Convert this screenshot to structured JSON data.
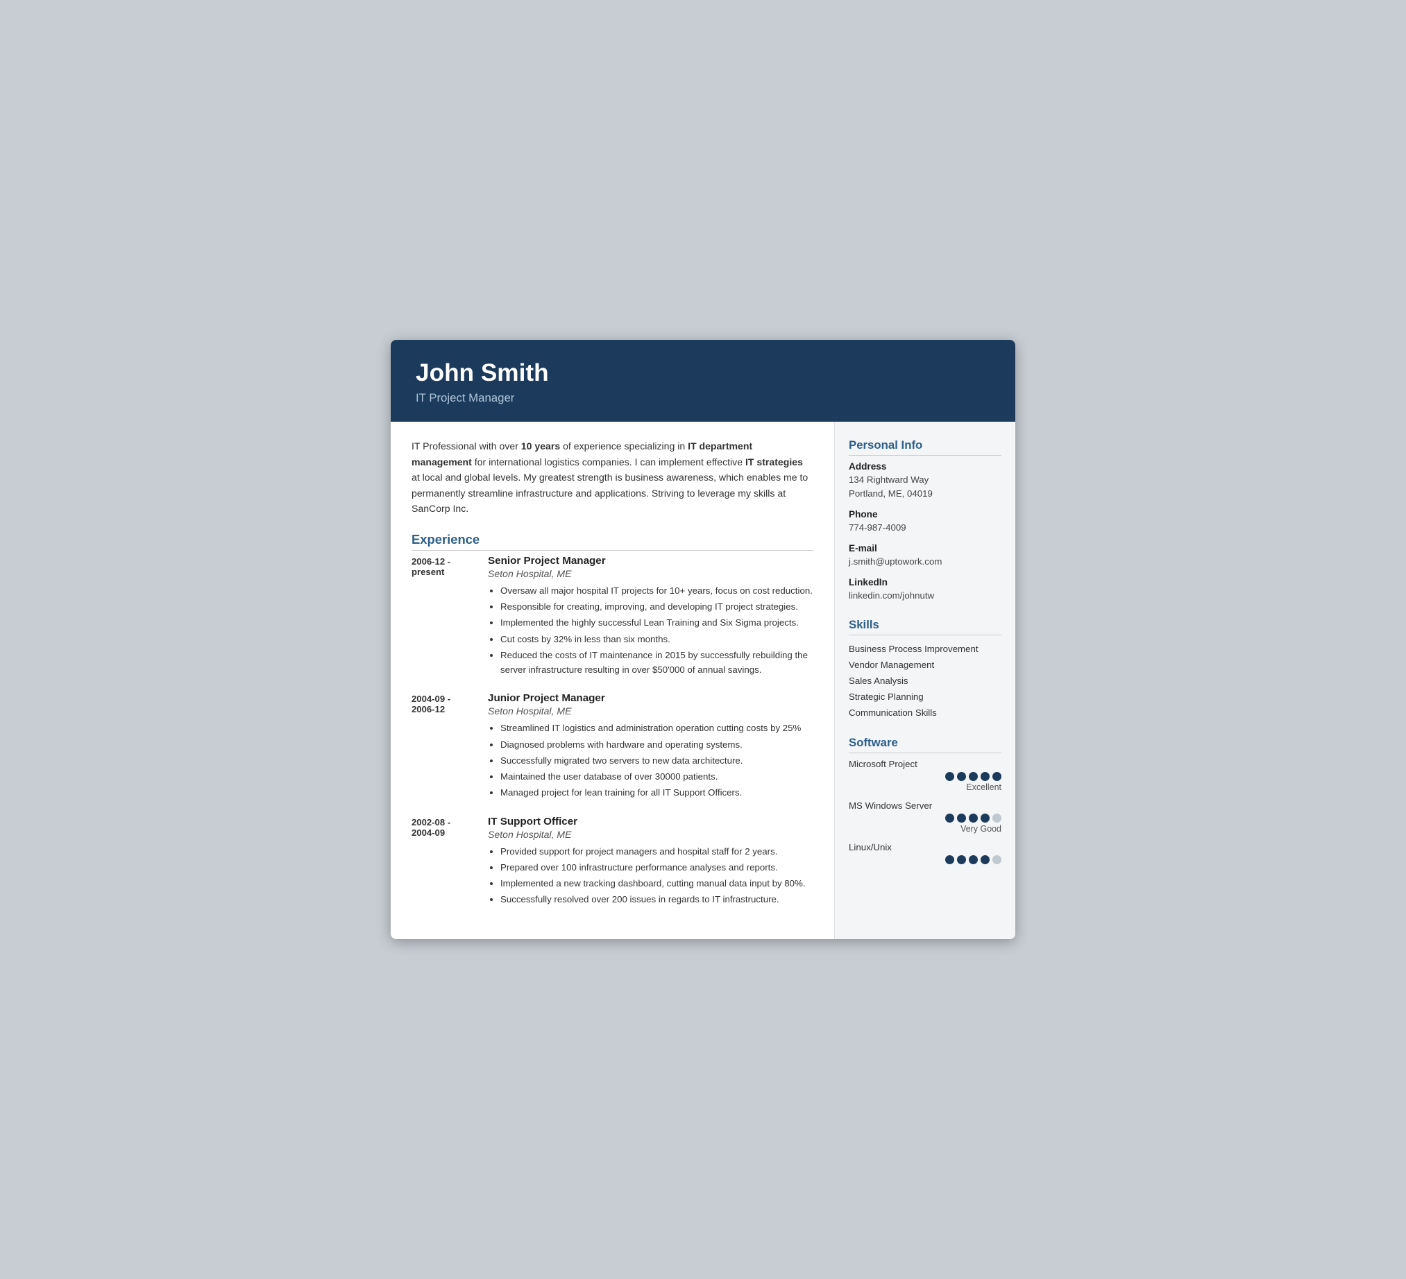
{
  "header": {
    "name": "John Smith",
    "title": "IT Project Manager"
  },
  "summary": {
    "text_parts": [
      {
        "text": "IT Professional with over ",
        "bold": false
      },
      {
        "text": "10 years",
        "bold": true
      },
      {
        "text": " of experience specializing in ",
        "bold": false
      },
      {
        "text": "IT department management",
        "bold": true
      },
      {
        "text": " for international logistics companies. I can implement effective ",
        "bold": false
      },
      {
        "text": "IT strategies",
        "bold": true
      },
      {
        "text": " at local and global levels. My greatest strength is business awareness, which enables me to permanently streamline infrastructure and applications. Striving to leverage my skills at SanCorp Inc.",
        "bold": false
      }
    ]
  },
  "experience": {
    "section_label": "Experience",
    "entries": [
      {
        "date_start": "2006-12 -",
        "date_end": "present",
        "title": "Senior Project Manager",
        "company": "Seton Hospital, ME",
        "bullets": [
          "Oversaw all major hospital IT projects for 10+ years, focus on cost reduction.",
          "Responsible for creating, improving, and developing IT project strategies.",
          "Implemented the highly successful Lean Training and Six Sigma projects.",
          "Cut costs by 32% in less than six months.",
          "Reduced the costs of IT maintenance in 2015 by successfully rebuilding the server infrastructure resulting in over $50'000 of annual savings."
        ]
      },
      {
        "date_start": "2004-09 -",
        "date_end": "2006-12",
        "title": "Junior Project Manager",
        "company": "Seton Hospital, ME",
        "bullets": [
          "Streamlined IT logistics and administration operation cutting costs by 25%",
          "Diagnosed problems with hardware and operating systems.",
          "Successfully migrated two servers to new data architecture.",
          "Maintained the user database of over 30000 patients.",
          "Managed project for lean training for all IT Support Officers."
        ]
      },
      {
        "date_start": "2002-08 -",
        "date_end": "2004-09",
        "title": "IT Support Officer",
        "company": "Seton Hospital, ME",
        "bullets": [
          "Provided support for project managers and hospital staff for 2 years.",
          "Prepared over 100 infrastructure performance analyses and reports.",
          "Implemented a new tracking dashboard, cutting manual data input by 80%.",
          "Successfully resolved over 200 issues in regards to IT infrastructure."
        ]
      }
    ]
  },
  "sidebar": {
    "personal_info": {
      "section_label": "Personal Info",
      "fields": [
        {
          "label": "Address",
          "value": "134 Rightward Way\nPortland, ME, 04019"
        },
        {
          "label": "Phone",
          "value": "774-987-4009"
        },
        {
          "label": "E-mail",
          "value": "j.smith@uptowork.com"
        },
        {
          "label": "LinkedIn",
          "value": "linkedin.com/johnutw"
        }
      ]
    },
    "skills": {
      "section_label": "Skills",
      "items": [
        "Business Process Improvement",
        "Vendor Management",
        "Sales Analysis",
        "Strategic Planning",
        "Communication Skills"
      ]
    },
    "software": {
      "section_label": "Software",
      "items": [
        {
          "name": "Microsoft Project",
          "filled": 5,
          "total": 5,
          "label": "Excellent"
        },
        {
          "name": "MS Windows Server",
          "filled": 4,
          "total": 5,
          "label": "Very Good"
        },
        {
          "name": "Linux/Unix",
          "filled": 4,
          "total": 5,
          "label": ""
        }
      ]
    }
  }
}
